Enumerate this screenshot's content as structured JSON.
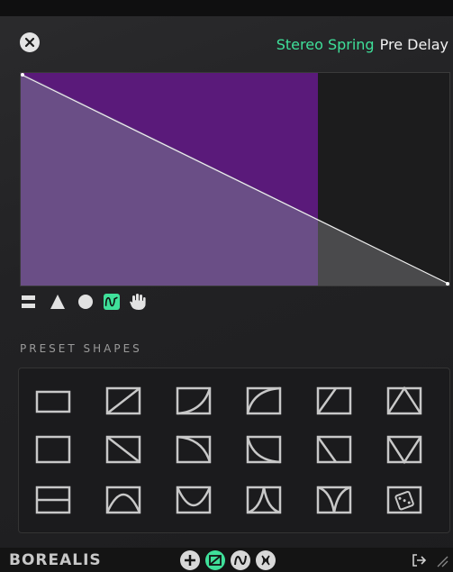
{
  "header": {
    "effect_name": "Stereo Spring",
    "param_name": "Pre Delay"
  },
  "graph": {
    "active_region_fraction": 0.7,
    "active_color": "#5a1a7a",
    "fill_color": "#6a4e86",
    "curve": "linear-down"
  },
  "toolbar": {
    "tools": [
      "flat-icon",
      "triangle-icon",
      "circle-icon",
      "wave-icon",
      "hand-icon"
    ],
    "active_tool": "wave-icon"
  },
  "presets": {
    "section_label": "PRESET SHAPES",
    "shapes": [
      "flat-shape-icon",
      "ramp-up-shape-icon",
      "curve-up-shape-icon",
      "log-up-shape-icon",
      "steep-up-shape-icon",
      "triangle-shape-icon",
      "flat-alt-shape-icon",
      "ramp-down-shape-icon",
      "curve-down-shape-icon",
      "log-down-shape-icon",
      "steep-down-shape-icon",
      "v-shape-icon",
      "split-shape-icon",
      "arch-shape-icon",
      "bowl-shape-icon",
      "peak-shape-icon",
      "valley-shape-icon",
      "random-dice-icon"
    ]
  },
  "footer": {
    "brand": "BOREALIS",
    "mod_icons": [
      "add-icon",
      "envelope-icon",
      "lfo-icon",
      "random-icon"
    ],
    "active_mod": "envelope-icon"
  },
  "colors": {
    "accent": "#3fe09a",
    "purple_dark": "#5a1a7a",
    "purple_light": "#6a4e86"
  }
}
